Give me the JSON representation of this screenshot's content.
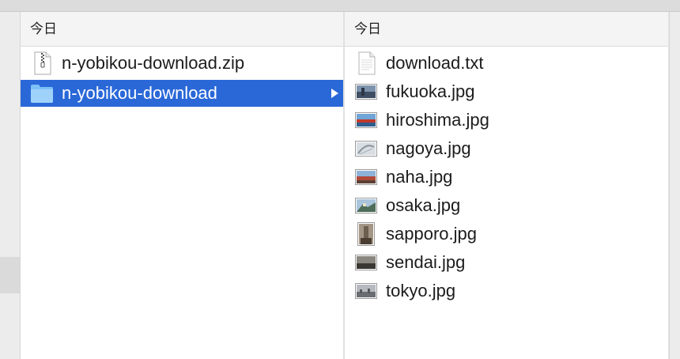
{
  "columns": [
    {
      "header": "今日",
      "items": [
        {
          "name": "n-yobikou-download.zip",
          "icon": "zip-file-icon",
          "selected": false
        },
        {
          "name": "n-yobikou-download",
          "icon": "folder-icon",
          "selected": true
        }
      ]
    },
    {
      "header": "今日",
      "items": [
        {
          "name": "download.txt",
          "icon": "text-file-icon"
        },
        {
          "name": "fukuoka.jpg",
          "icon": "image-thumbnail-icon",
          "thumb_color": "#5a6f8a"
        },
        {
          "name": "hiroshima.jpg",
          "icon": "image-thumbnail-icon",
          "thumb_color": "#c0392b"
        },
        {
          "name": "nagoya.jpg",
          "icon": "image-thumbnail-icon",
          "thumb_color": "#b8c2cc"
        },
        {
          "name": "naha.jpg",
          "icon": "image-thumbnail-icon",
          "thumb_color": "#b24a3a"
        },
        {
          "name": "osaka.jpg",
          "icon": "image-thumbnail-icon",
          "thumb_color": "#5f7f6a"
        },
        {
          "name": "sapporo.jpg",
          "icon": "image-thumbnail-icon",
          "thumb_color": "#7a6a5a"
        },
        {
          "name": "sendai.jpg",
          "icon": "image-thumbnail-icon",
          "thumb_color": "#4d4a45"
        },
        {
          "name": "tokyo.jpg",
          "icon": "image-thumbnail-icon",
          "thumb_color": "#8d9096"
        }
      ]
    }
  ],
  "colors": {
    "selection": "#2a68d8",
    "folder": "#6cb6f5"
  }
}
